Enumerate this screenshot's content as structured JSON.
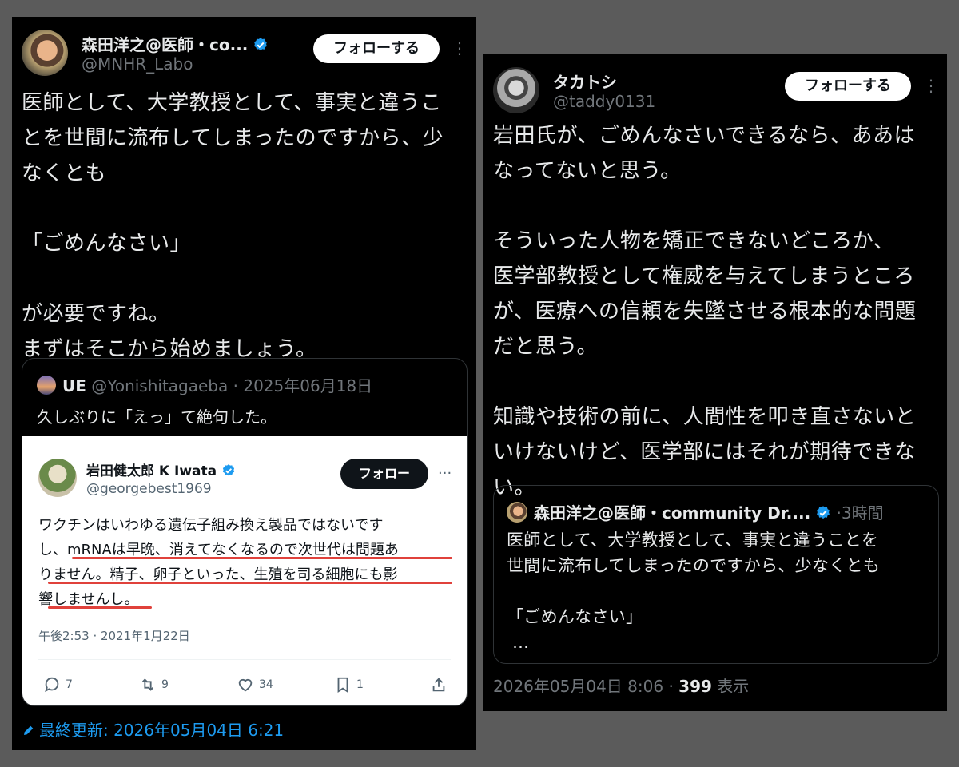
{
  "left": {
    "author_name": "森田洋之@医師・co...",
    "author_handle": "@MNHR_Labo",
    "follow_label": "フォローする",
    "more_icon": "more-icon",
    "body": "医師として、大学教授として、事実と違うこ\nとを世間に流布してしまったのですから、少\nなくとも\n\n「ごめんなさい」\n\nが必要ですね。\nまずはそこから始めましょう。",
    "quote": {
      "name": "UE",
      "handle": "@Yonishitagaeba",
      "sep": "·",
      "date": "2025年06月18日",
      "text": "久しぶりに「えっ」て絶句した。",
      "inner": {
        "name": "岩田健太郎 K Iwata",
        "handle": "@georgebest1969",
        "follow_label": "フォロー",
        "text": "ワクチンはいわゆる遺伝子組み換え製品ではないです\nし、mRNAは早晩、消えてなくなるので次世代は問題あ\nりません。精子、卵子といった、生殖を司る細胞にも影\n響しませんし。",
        "time": "午後2:53 · 2021年1月22日",
        "replies": "7",
        "retweets": "9",
        "likes": "34",
        "bookmarks": "1"
      }
    },
    "updated_label": "最終更新: 2026年05月04日 6:21"
  },
  "right": {
    "author_name": "タカトシ",
    "author_handle": "@taddy0131",
    "follow_label": "フォローする",
    "body": "岩田氏が、ごめんなさいできるなら、ああは\nなってないと思う。\n\nそういった人物を矯正できないどころか、\n医学部教授として権威を与えてしまうところ\nが、医療への信頼を失墜させる根本的な問題\nだと思う。\n\n知識や技術の前に、人間性を叩き直さないと\nいけないけど、医学部にはそれが期待できな\nい。",
    "quote": {
      "name": "森田洋之@医師・community Dr....",
      "sep": "·",
      "time": "3時間",
      "text": "医師として、大学教授として、事実と違うことを\n世間に流布してしまったのですから、少なくとも\n\n「ごめんなさい」\n …"
    },
    "timestamp": "2026年05月04日 8:06",
    "dot": "·",
    "views_count": "399",
    "views_label": "表示"
  },
  "colors": {
    "accent": "#1d9bf0",
    "highlight": "#e0413b",
    "background": "#000000"
  }
}
